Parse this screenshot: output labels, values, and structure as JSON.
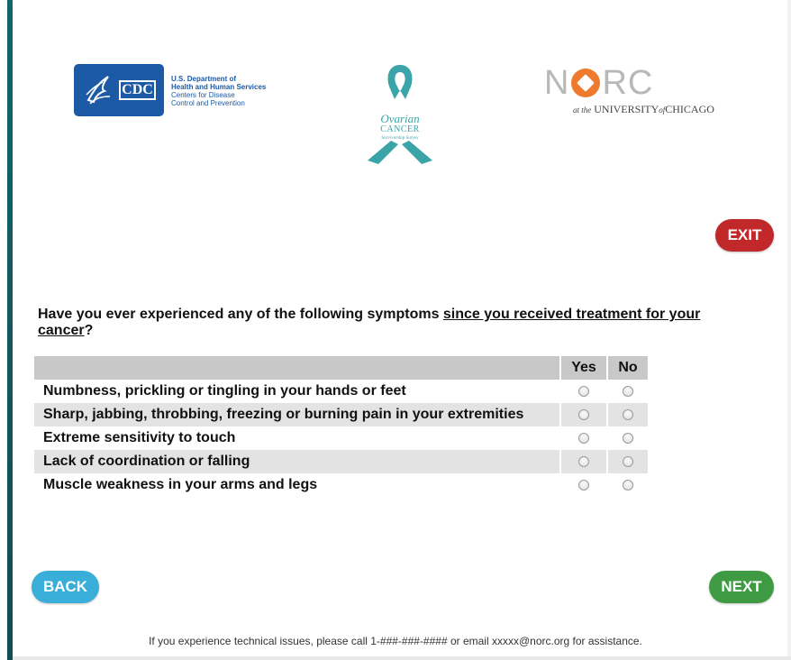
{
  "logos": {
    "cdc": {
      "badge_text": "CDC",
      "line1": "U.S. Department of",
      "line2": "Health and Human Services",
      "line3": "Centers for Disease",
      "line4": "Control and Prevention"
    },
    "ribbon": {
      "line1": "Ovarian",
      "line2": "CANCER",
      "line3": "Survivorship Survey",
      "color": "#3aa4a9"
    },
    "norc": {
      "n": "N",
      "rc": "RC",
      "sub_at": "at the",
      "sub_univ": "UNIVERSITY",
      "sub_of": "of",
      "sub_chicago": "CHICAGO"
    }
  },
  "buttons": {
    "exit": "EXIT",
    "back": "BACK",
    "next": "NEXT"
  },
  "question": {
    "prefix": "Have you ever experienced any of the following symptoms ",
    "underlined": "since you received treatment for your cancer",
    "suffix": "?"
  },
  "grid": {
    "columns": [
      "Yes",
      "No"
    ],
    "rows": [
      "Numbness, prickling or tingling in your hands or feet",
      "Sharp, jabbing, throbbing, freezing or burning pain in your extremities",
      "Extreme sensitivity to touch",
      "Lack of coordination or falling",
      "Muscle weakness in your arms and legs"
    ]
  },
  "footer": "If you experience technical issues, please call 1-###-###-#### or email xxxxx@norc.org for assistance.",
  "colors": {
    "exit": "#c0282a",
    "back": "#38aed8",
    "next": "#3e9b43",
    "cdc_blue": "#1c5aa6",
    "norc_orange": "#ee7a2d"
  }
}
